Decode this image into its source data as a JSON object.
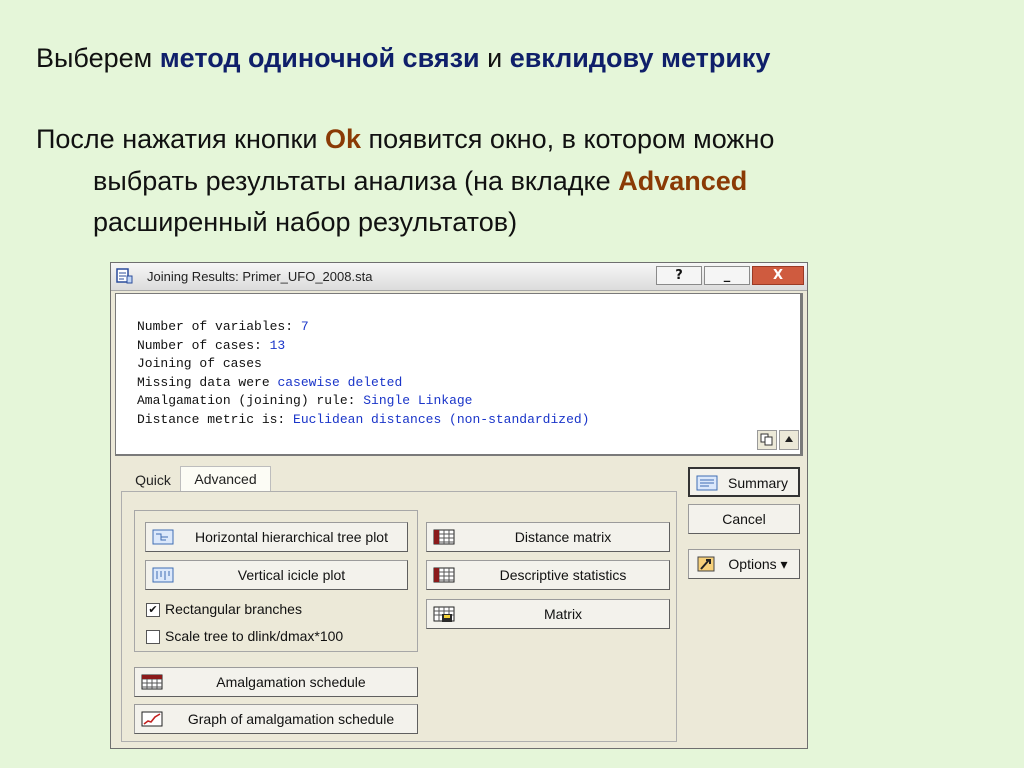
{
  "slide": {
    "line1_prefix": "Выберем ",
    "line1_method": "метод одиночной связи",
    "line1_mid": " и ",
    "line1_metric": "евклидову метрику",
    "line2_prefix": "После нажатия кнопки ",
    "line2_ok": "Ok",
    "line2_suffix": " появится окно, в котором можно",
    "line3_prefix": "выбрать результаты анализа (на вкладке ",
    "line3_adv": "Advanced",
    "line4": "расширенный набор результатов)"
  },
  "window": {
    "title": "Joining Results: Primer_UFO_2008.sta",
    "help_label": "?",
    "min_label": "_",
    "close_label": "X"
  },
  "output": {
    "l1_label": "Number of variables: ",
    "l1_value": "7",
    "l2_label": "Number of cases: ",
    "l2_value": "13",
    "l3_label": "Joining of cases",
    "l4_label": "Missing data were ",
    "l4_value": "casewise deleted",
    "l5_label": "Amalgamation (joining) rule: ",
    "l5_value": "Single Linkage",
    "l6_label": "Distance metric is: ",
    "l6_value": "Euclidean distances (non-standardized)"
  },
  "tabs": {
    "quick": "Quick",
    "advanced": "Advanced"
  },
  "buttons": {
    "horizontal_tree": "Horizontal hierarchical tree plot",
    "vertical_icicle": "Vertical icicle plot",
    "distance_matrix": "Distance matrix",
    "descriptive_stats": "Descriptive statistics",
    "matrix": "Matrix",
    "amalgamation_schedule": "Amalgamation schedule",
    "graph_amalgamation": "Graph of amalgamation schedule",
    "summary": "Summary",
    "cancel": "Cancel",
    "options": "Options"
  },
  "checkboxes": {
    "rectangular": {
      "label": "Rectangular branches",
      "checked": true
    },
    "scale": {
      "label": "Scale tree to dlink/dmax*100",
      "checked": false
    }
  },
  "colors": {
    "slide_bg": "#e5f6d9",
    "keyword_blue": "#0f1f6a",
    "keyword_brown": "#8a3a05",
    "value_blue": "#1a35c9"
  }
}
